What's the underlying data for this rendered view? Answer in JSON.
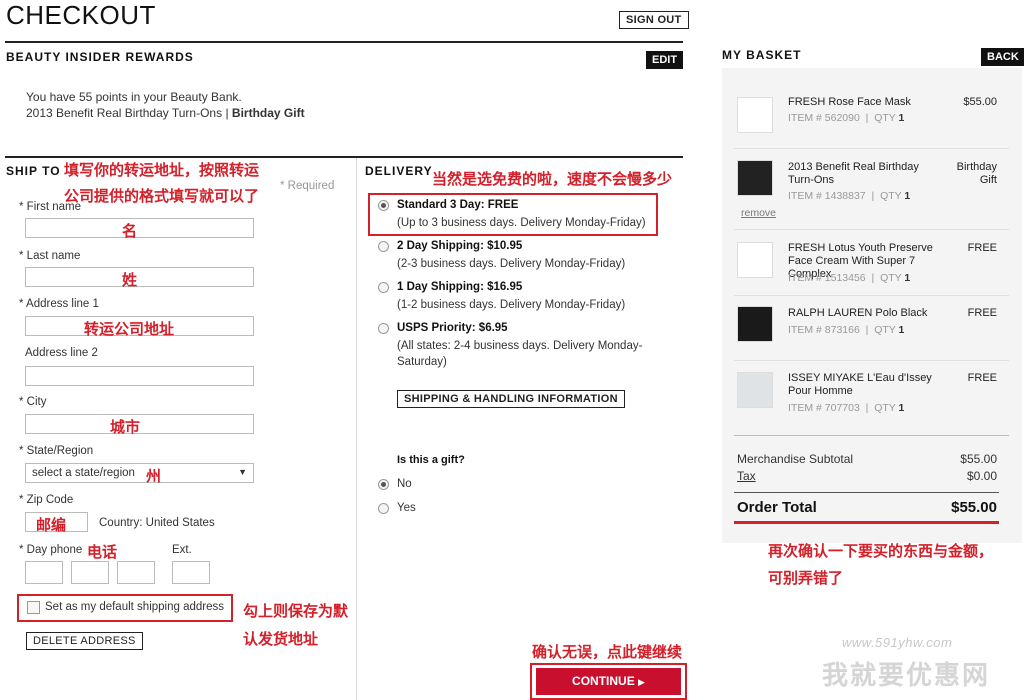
{
  "header": {
    "title": "CHECKOUT",
    "sign_out": "SIGN OUT"
  },
  "rewards": {
    "heading": "BEAUTY INSIDER REWARDS",
    "edit": "EDIT",
    "points_text": "You have 55 points in your Beauty Bank.",
    "gift_text": "2013 Benefit Real Birthday Turn-Ons |",
    "gift_bold": "Birthday Gift"
  },
  "ship_to": {
    "heading": "SHIP TO",
    "required": "* Required",
    "first_name": "* First name",
    "last_name": "* Last name",
    "address1": "* Address line 1",
    "address2": "Address line 2",
    "city": "* City",
    "state": "* State/Region",
    "state_placeholder": "select a state/region",
    "zip": "* Zip Code",
    "country": "Country: United States",
    "phone": "* Day phone",
    "ext": "Ext.",
    "default_checkbox": "Set as my default shipping address",
    "delete": "DELETE ADDRESS"
  },
  "delivery": {
    "heading": "DELIVERY",
    "options": [
      {
        "title": "Standard 3 Day: FREE",
        "desc": "(Up to 3 business days. Delivery Monday-Friday)",
        "selected": true
      },
      {
        "title": "2 Day Shipping: $10.95",
        "desc": "(2-3 business days. Delivery Monday-Friday)",
        "selected": false
      },
      {
        "title": "1 Day Shipping: $16.95",
        "desc": "(1-2 business days. Delivery Monday-Friday)",
        "selected": false
      },
      {
        "title": "USPS Priority: $6.95",
        "desc": "(All states: 2-4 business days. Delivery Monday-Saturday)",
        "selected": false
      }
    ],
    "shipping_info": "SHIPPING & HANDLING INFORMATION",
    "gift_question": "Is this a gift?",
    "gift_no": "No",
    "gift_yes": "Yes",
    "continue": "CONTINUE"
  },
  "basket": {
    "heading": "MY BASKET",
    "back": "BACK",
    "items": [
      {
        "name": "FRESH Rose Face Mask",
        "item_no": "562090",
        "qty": "1",
        "price": "$55.00"
      },
      {
        "name": "2013 Benefit Real Birthday Turn-Ons",
        "item_no": "1438837",
        "qty": "1",
        "price": "Birthday Gift",
        "remove": "remove"
      },
      {
        "name": "FRESH Lotus Youth Preserve Face Cream With Super 7 Complex",
        "item_no": "1513456",
        "qty": "1",
        "price": "FREE"
      },
      {
        "name": "RALPH LAUREN Polo Black",
        "item_no": "873166",
        "qty": "1",
        "price": "FREE"
      },
      {
        "name": "ISSEY MIYAKE L'Eau d'Issey Pour Homme",
        "item_no": "707703",
        "qty": "1",
        "price": "FREE"
      }
    ],
    "item_label": "ITEM #",
    "qty_label": "QTY",
    "subtotal_label": "Merchandise Subtotal",
    "subtotal": "$55.00",
    "tax_label": "Tax",
    "tax": "$0.00",
    "total_label": "Order Total",
    "total": "$55.00"
  },
  "annotations": {
    "ship_note_1": "填写你的转运地址，按照转运",
    "ship_note_2": "公司提供的格式填写就可以了",
    "first_name": "名",
    "last_name": "姓",
    "address": "转运公司地址",
    "city": "城市",
    "state": "州",
    "zip": "邮编",
    "phone": "电话",
    "delivery_note": "当然是选免费的啦，速度不会慢多少",
    "default_note_1": "勾上则保存为默",
    "default_note_2": "认发货地址",
    "confirm_note_1": "再次确认一下要买的东西与金额，",
    "confirm_note_2": "可别弄错了",
    "continue_note": "确认无误，点此键继续"
  },
  "watermark": {
    "url": "www.591yhw.com",
    "name": "我就要优惠网"
  },
  "colors": {
    "annotation_red": "#d3202a",
    "basket_bg": "#f4f4f4",
    "black": "#111111"
  }
}
